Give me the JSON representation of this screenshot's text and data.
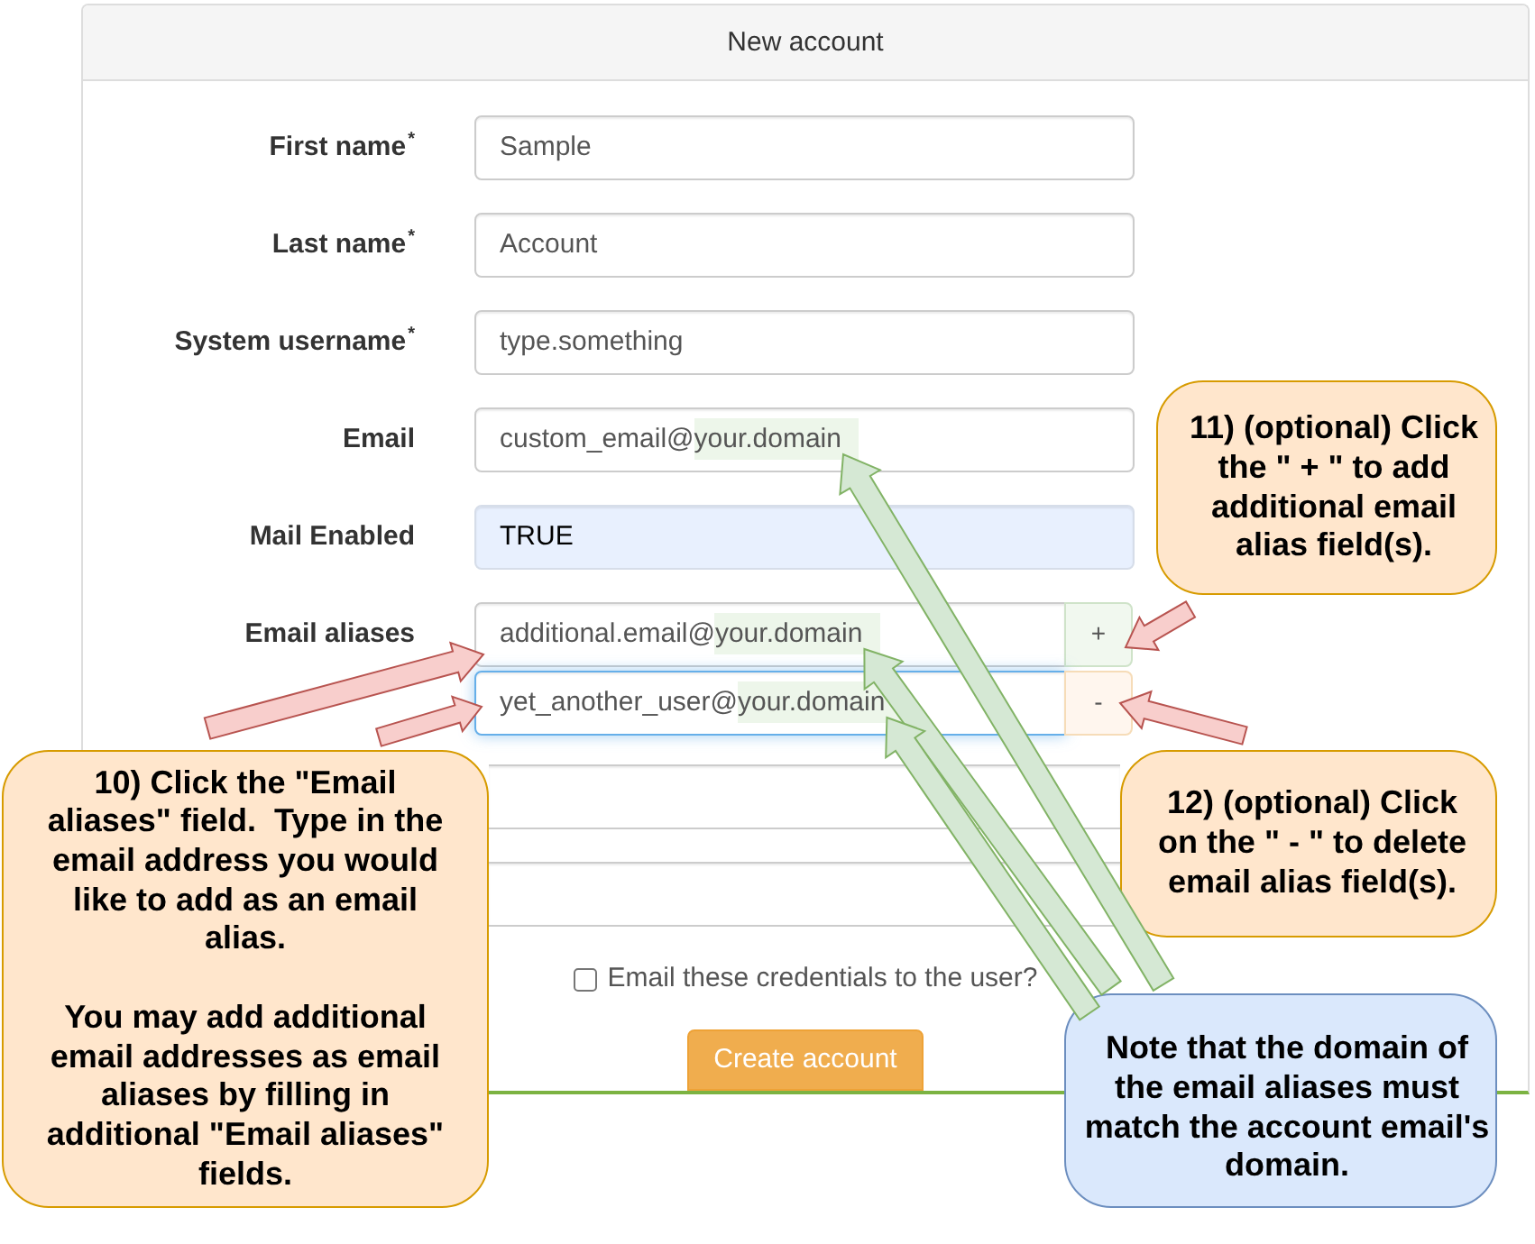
{
  "panel": {
    "title": "New account"
  },
  "fields": [
    {
      "label": "First name$^{*}$",
      "value": "Sample",
      "autofilled": false
    },
    {
      "label": "Last name$^{*}$",
      "value": "Account",
      "autofilled": false
    },
    {
      "label": "System username$^{*}$",
      "value": "type.something",
      "autofilled": false
    },
    {
      "label": "Email",
      "value": "custom_email@your.domain",
      "domain_highlighted": true,
      "autofilled": false
    },
    {
      "label": "Mail Enabled",
      "value": "TRUE",
      "autofilled": true
    }
  ],
  "email_aliases": {
    "label": "Email aliases",
    "entries": [
      {
        "value": "additional.email@your.domain",
        "domain_highlighted": true,
        "focused": false,
        "button": {
          "kind": "add",
          "label": "+"
        }
      },
      {
        "value": "yet_another_user@your.domain",
        "domain_highlighted": true,
        "focused": true,
        "button": {
          "kind": "remove",
          "label": "-"
        }
      }
    ]
  },
  "extra_fields": [
    {
      "kind": "text_input"
    },
    {
      "kind": "text_input"
    }
  ],
  "send_credentials": {
    "label": "Email these credentials to the user?",
    "checked": false
  },
  "submit_button": {
    "label": "Create account"
  },
  "callouts": [
    {
      "kind": "step",
      "paragraphs": [
        "11) (optional) Click the \" + \" to add additional email alias field(s)."
      ]
    },
    {
      "kind": "step",
      "paragraphs": [
        "10) Click the \"Email aliases\" field.  Type in the email address you would like to add as an email alias.",
        "You may add additional email addresses as email aliases by filling in additional \"Email aliases\" fields."
      ]
    },
    {
      "kind": "step",
      "paragraphs": [
        "12) (optional) Click on the \" - \" to delete email alias field(s)."
      ]
    },
    {
      "kind": "note",
      "paragraphs": [
        "Note that the domain of the email aliases must match the account email's domain."
      ]
    }
  ]
}
